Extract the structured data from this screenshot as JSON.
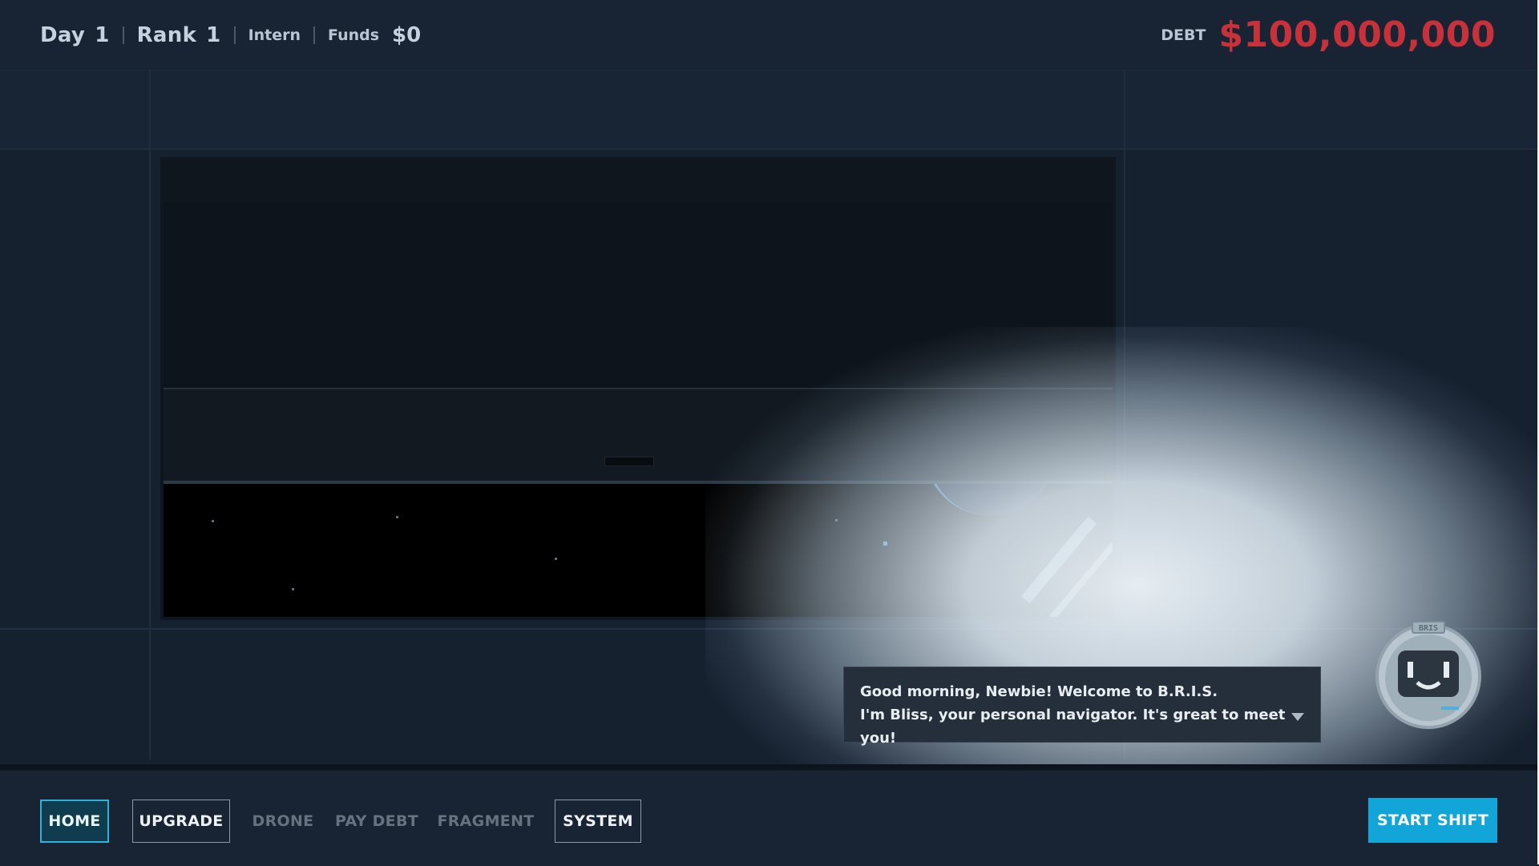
{
  "hud": {
    "day_label": "Day",
    "day_value": "1",
    "rank_label": "Rank",
    "rank_value": "1",
    "title": "Intern",
    "funds_label": "Funds",
    "funds_value": "$0",
    "debt_label": "DEBT",
    "debt_value": "$100,000,000"
  },
  "dialogue": {
    "line1": "Good morning, Newbie! Welcome to B.R.I.S.",
    "line2": "I'm Bliss, your personal navigator. It's great to meet you!"
  },
  "robot": {
    "visor_text": "BRIS"
  },
  "nav": {
    "home": "HOME",
    "upgrade": "UPGRADE",
    "drone": "DRONE",
    "pay_debt": "PAY DEBT",
    "fragment": "FRAGMENT",
    "system": "SYSTEM",
    "start_shift": "START SHIFT"
  },
  "colors": {
    "debt": "#c7323a",
    "accent": "#11a5d8",
    "home_active_border": "#2bb3d8"
  }
}
